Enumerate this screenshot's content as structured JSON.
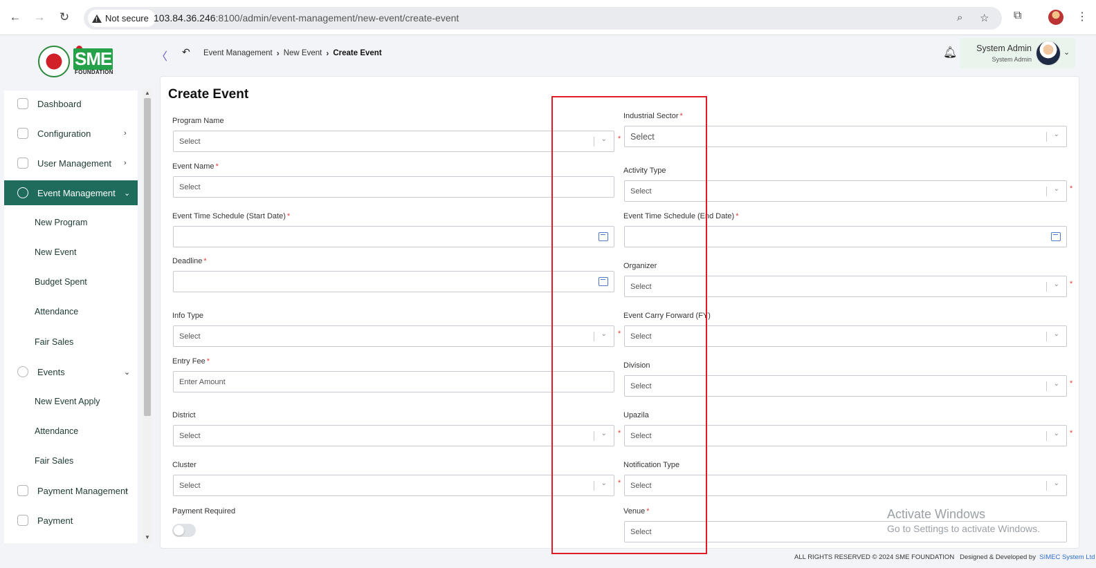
{
  "browser": {
    "security_label": "Not secure",
    "url_host": "103.84.36.246",
    "url_path": ":8100/admin/event-management/new-event/create-event"
  },
  "header": {
    "logo_text": "SME",
    "logo_sub": "FOUNDATION",
    "breadcrumb": [
      "Event Management",
      "New Event",
      "Create Event"
    ],
    "user_name": "System Admin",
    "user_role": "System Admin"
  },
  "sidebar": {
    "dashboard": "Dashboard",
    "configuration": "Configuration",
    "user_management": "User Management",
    "event_management": "Event Management",
    "new_program": "New Program",
    "new_event": "New Event",
    "budget_spent": "Budget Spent",
    "attendance": "Attendance",
    "fair_sales": "Fair Sales",
    "events": "Events",
    "new_event_apply": "New Event Apply",
    "events_attendance": "Attendance",
    "events_fair_sales": "Fair Sales",
    "payment_management": "Payment Management",
    "payment": "Payment"
  },
  "form": {
    "title": "Create Event",
    "required_mark": "*",
    "program_name": {
      "label": "Program Name",
      "placeholder": "Select"
    },
    "industrial_sector": {
      "label": "Industrial Sector",
      "placeholder": "Select"
    },
    "event_name": {
      "label": "Event Name",
      "placeholder": "Select"
    },
    "activity_type": {
      "label": "Activity Type",
      "placeholder": "Select"
    },
    "start_date": {
      "label": "Event Time Schedule (Start Date)"
    },
    "end_date": {
      "label": "Event Time Schedule (End Date)"
    },
    "deadline": {
      "label": "Deadline"
    },
    "organizer": {
      "label": "Organizer",
      "placeholder": "Select"
    },
    "info_type": {
      "label": "Info Type",
      "placeholder": "Select"
    },
    "carry_forward": {
      "label": "Event Carry Forward (FY)",
      "placeholder": "Select"
    },
    "entry_fee": {
      "label": "Entry Fee",
      "placeholder": "Enter Amount"
    },
    "division": {
      "label": "Division",
      "placeholder": "Select"
    },
    "district": {
      "label": "District",
      "placeholder": "Select"
    },
    "upazila": {
      "label": "Upazila",
      "placeholder": "Select"
    },
    "cluster": {
      "label": "Cluster",
      "placeholder": "Select"
    },
    "notification_type": {
      "label": "Notification Type",
      "placeholder": "Select"
    },
    "payment_required": {
      "label": "Payment Required",
      "enabled": false
    },
    "venue": {
      "label": "Venue",
      "placeholder": "Select"
    }
  },
  "watermark": {
    "title": "Activate Windows",
    "subtitle": "Go to Settings to activate Windows."
  },
  "footer": {
    "copyright": "ALL RIGHTS RESERVED © 2024 SME FOUNDATION",
    "designed_by": "Designed & Developed by",
    "company": "SIMEC System Ltd"
  },
  "colors": {
    "sidebar_active": "#1f6b5c",
    "required": "#e53935",
    "highlight": "#e01b24",
    "logo_green": "#25a14a"
  }
}
